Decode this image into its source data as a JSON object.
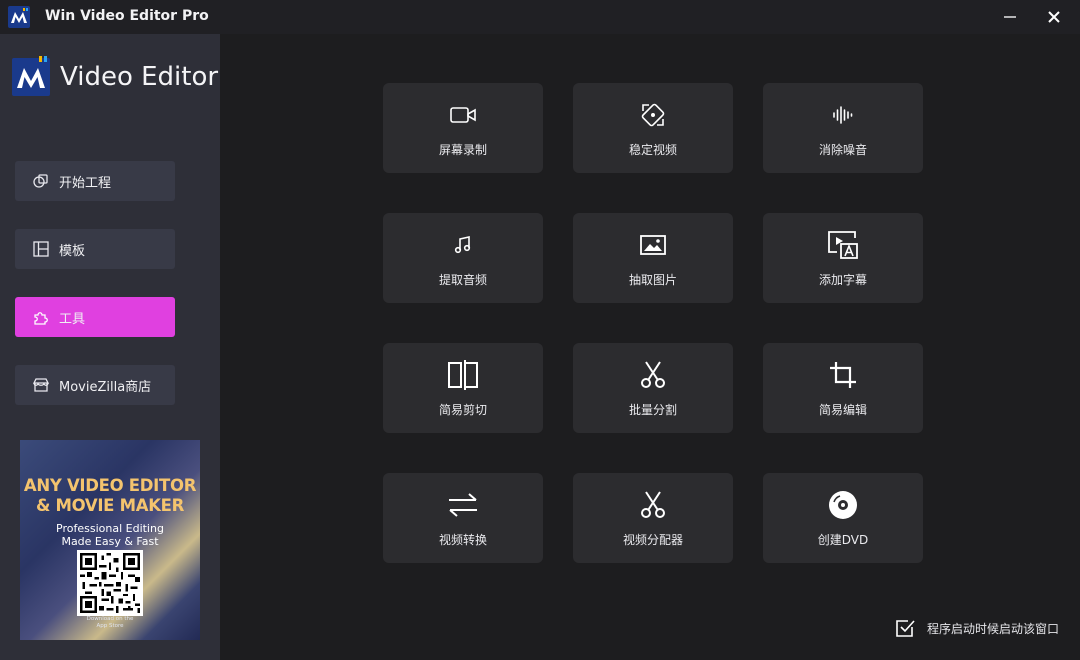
{
  "titlebar": {
    "title": "Win Video Editor Pro",
    "icons": {
      "app": "app-logo-icon",
      "minimize": "minimize-icon",
      "close": "close-icon"
    }
  },
  "sidebar": {
    "brand": "Video Editor",
    "items": [
      {
        "label": "开始工程",
        "icon": "new-project-icon"
      },
      {
        "label": "模板",
        "icon": "template-icon"
      },
      {
        "label": "工具",
        "icon": "puzzle-icon",
        "active": true
      },
      {
        "label": "MovieZilla商店",
        "icon": "store-icon"
      }
    ],
    "promo": {
      "title_line1": "ANY VIDEO EDITOR",
      "title_line2": "& MOVIE MAKER",
      "sub_line1": "Professional Editing",
      "sub_line2": "Made Easy & Fast",
      "store_line1": "Download on the",
      "store_line2": "App Store"
    }
  },
  "tools": [
    {
      "label": "屏幕录制",
      "icon": "video-camera-icon"
    },
    {
      "label": "稳定视频",
      "icon": "stabilize-icon"
    },
    {
      "label": "消除噪音",
      "icon": "waveform-icon"
    },
    {
      "label": "提取音频",
      "icon": "music-note-icon"
    },
    {
      "label": "抽取图片",
      "icon": "image-icon"
    },
    {
      "label": "添加字幕",
      "icon": "subtitle-icon"
    },
    {
      "label": "简易剪切",
      "icon": "trim-icon"
    },
    {
      "label": "批量分割",
      "icon": "scissors-icon"
    },
    {
      "label": "简易编辑",
      "icon": "crop-icon"
    },
    {
      "label": "视频转换",
      "icon": "convert-arrows-icon"
    },
    {
      "label": "视频分配器",
      "icon": "scissors-icon"
    },
    {
      "label": "创建DVD",
      "icon": "disc-icon"
    }
  ],
  "startup": {
    "label": "程序启动时候启动该窗口",
    "checked": true
  },
  "colors": {
    "accent": "#e040e0",
    "sidebar": "#2e2f38",
    "tile": "#2c2c2f",
    "background": "#1d1d1f",
    "promo_title": "#f4c46e"
  }
}
